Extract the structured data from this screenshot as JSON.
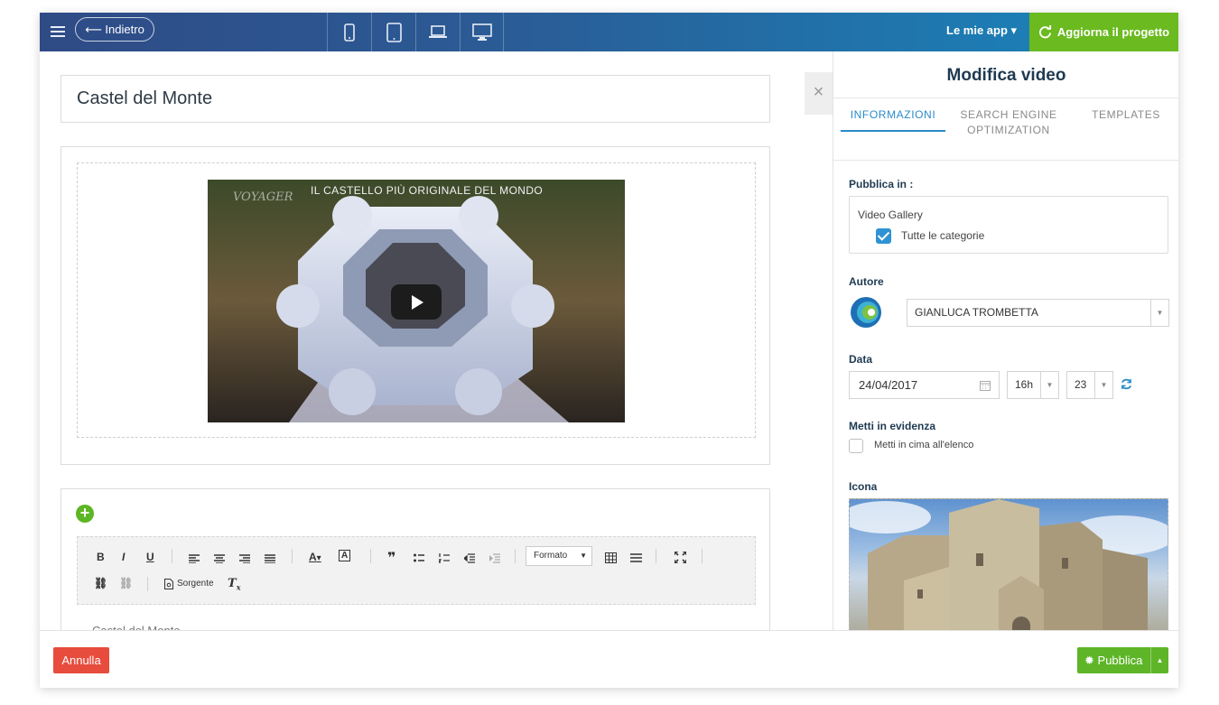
{
  "topbar": {
    "back_label": "⟵ Indietro",
    "devices": [
      "mobile-icon",
      "tablet-icon",
      "laptop-icon",
      "desktop-icon"
    ],
    "my_apps_label": "Le mie app ▾",
    "update_label": "Aggiorna il progetto",
    "accent_color": "#6aba20"
  },
  "editor": {
    "title_value": "Castel del Monte",
    "video": {
      "overlay_title": "IL CASTELLO PIÙ ORIGINALE DEL MONDO",
      "watermark": "VOYAGER"
    },
    "toolbar": {
      "buttons_row1": [
        "B",
        "I",
        "U",
        "align-left",
        "align-center",
        "align-right",
        "justify",
        "A▾",
        "A▾",
        "quote",
        "bullets",
        "numbers",
        "outdent",
        "indent"
      ],
      "format_label": "Formato",
      "source_label": "Sorgente"
    },
    "body_text": "Castel del Monte"
  },
  "panel": {
    "title": "Modifica video",
    "tabs": [
      {
        "label": "INFORMAZIONI",
        "active": true
      },
      {
        "label": "SEARCH ENGINE OPTIMIZATION",
        "active": false
      },
      {
        "label": "TEMPLATES",
        "active": false
      }
    ],
    "publish_in_label": "Pubblica in :",
    "category_name": "Video Gallery",
    "all_categories_label": "Tutte le categorie",
    "all_categories_checked": true,
    "author_label": "Autore",
    "author_value": "GIANLUCA TROMBETTA",
    "date_label": "Data",
    "date_value": "24/04/2017",
    "hour_value": "16h",
    "minute_value": "23",
    "highlight_label": "Metti in evidenza",
    "highlight_option": "Metti in cima all'elenco",
    "highlight_checked": false,
    "icon_label": "Icona"
  },
  "footer": {
    "cancel_label": "Annulla",
    "publish_label": "Pubblica",
    "cancel_color": "#e74c3c",
    "publish_color": "#5eb528"
  }
}
